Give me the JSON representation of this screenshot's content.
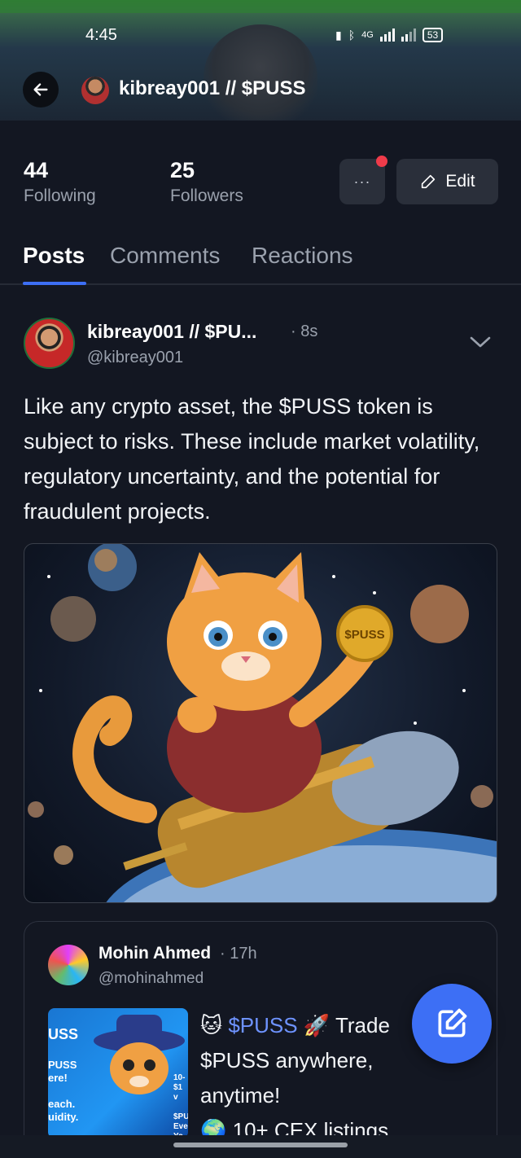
{
  "status_bar": {
    "time": "4:45",
    "network": "4G",
    "battery": "53"
  },
  "header": {
    "title": "kibreay001 // $PUSS"
  },
  "stats": {
    "following_count": "44",
    "following_label": "Following",
    "followers_count": "25",
    "followers_label": "Followers"
  },
  "buttons": {
    "more": "···",
    "edit": "Edit"
  },
  "tabs": [
    {
      "label": "Posts",
      "active": true
    },
    {
      "label": "Comments",
      "active": false
    },
    {
      "label": "Reactions",
      "active": false
    }
  ],
  "post": {
    "author": "kibreay001 // $PU...",
    "time": "· 8s",
    "handle": "@kibreay001",
    "text": "Like any crypto asset, the $PUSS token is subject to risks. These include market volatility, regulatory uncertainty, and the potential for fraudulent projects.",
    "image_coin_label": "$PUSS"
  },
  "quoted_post": {
    "author": "Mohin Ahmed",
    "time": "· 17h",
    "handle": "@mohinahmed",
    "tag": "$PUSS",
    "text_after_tag": " Trade",
    "line2": "$PUSS anywhere,",
    "line3": "anytime!",
    "line4": "10+ CEX listings",
    "thumb_title": "USS",
    "thumb_lines": "PUSS\nere!\n\neach.\nuidity.",
    "thumb_right": "10-\n$1\nv\n\n$PU\nEve\nYo"
  },
  "icons": {
    "back": "arrow-left-icon",
    "chevron": "chevron-down-icon",
    "edit": "pencil-icon",
    "compose": "compose-icon"
  },
  "colors": {
    "accent": "#3d6ff5",
    "notification": "#ef3b4a",
    "background": "#131722"
  }
}
